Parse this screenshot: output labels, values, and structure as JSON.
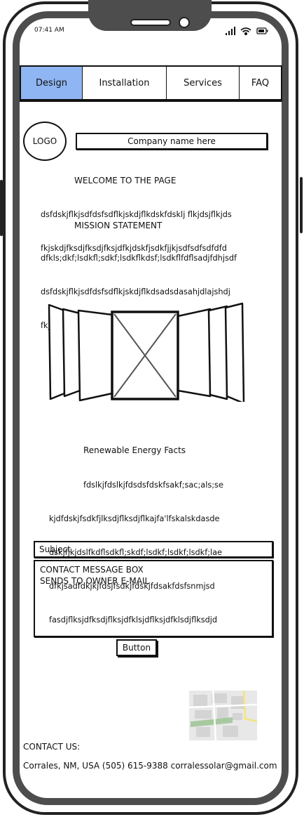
{
  "status_bar": {
    "time": "07:41 AM",
    "icons": [
      "signal-icon",
      "wifi-icon",
      "battery-icon"
    ]
  },
  "nav": {
    "tabs": [
      {
        "label": "Design",
        "active": true
      },
      {
        "label": "Installation",
        "active": false
      },
      {
        "label": "Services",
        "active": false
      },
      {
        "label": "FAQ",
        "active": false
      }
    ]
  },
  "header": {
    "logo": "LOGO",
    "company_name": "Company name here"
  },
  "welcome": {
    "title": "WELCOME TO THE PAGE",
    "lines": [
      "dsfdskjflkjsdfdsfsdflkjskdjflkdskfdsklj flkjdsjflkjds",
      "fkjskdjfksdjfksdjfksjdfkjdskfjsdkfjjkjsdfsdfsdfdfd"
    ]
  },
  "mission": {
    "title": "MISSION STATEMENT",
    "lines": [
      "dfkls;dkf;lsdkfl;sdkf;lsdkflkdsf;lsdkflfdflsadjfdhjsdf",
      "dsfdskjflkjsdfdsfsdflkjskdjflkdsadsdasahjdlajshdj",
      "fkjskdjfksdjfksdjfksjdfkjdskfjsdkfjjkjdjsahdkjashs"
    ]
  },
  "facts": {
    "title": "Renewable Energy Facts",
    "lines": [
      "fdslkjfdslkjfdsdsfdskfsakf;sac;als;se",
      "kjdfdskjfsdkfjlksdjflksdjflkajfa'lfskalskdasde",
      "dskjfjkjdslfkdflsdkfl;skdf;lsdkf;lsdkf;lsdkf;lae",
      "dfkjsadfdkjkjfdsjfsdkjfdskjfdsakfdsfsnmjsd",
      "fasdjflksjdfksdjflksjdfklsjdflksjdfklsdjflksdjd"
    ]
  },
  "form": {
    "subject_placeholder": "Subject",
    "message_lines": [
      "CONTACT MESSAGE BOX",
      "SENDS TO OWNER E-MAIL"
    ],
    "button_label": "Button"
  },
  "contact": {
    "title": "CONTACT US:",
    "details": "Corrales, NM, USA (505) 615-9388 corralessolar@gmail.com"
  },
  "colors": {
    "active_tab": "#8fb5f2",
    "frame": "#4d4d4d"
  }
}
